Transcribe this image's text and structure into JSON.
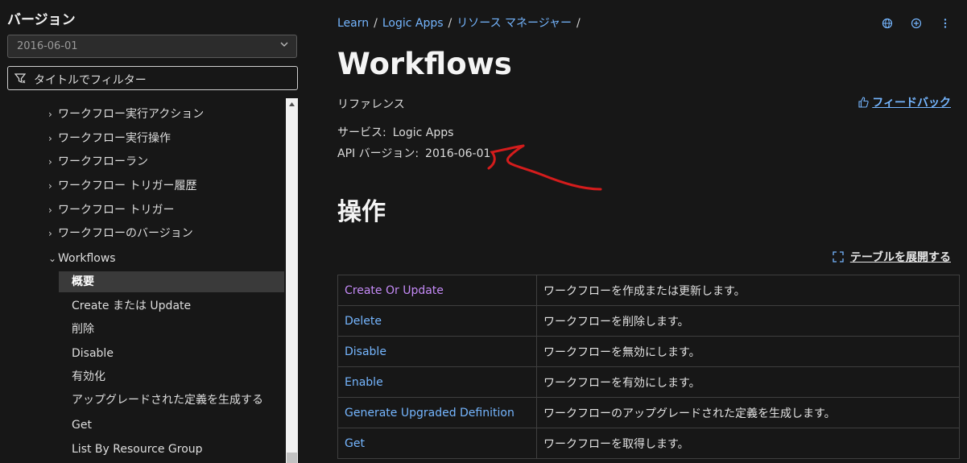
{
  "sidebar": {
    "title": "バージョン",
    "version": "2016-06-01",
    "filter_placeholder": "タイトルでフィルター",
    "items": [
      {
        "label": "ワークフロー実行アクション",
        "arrow": "›"
      },
      {
        "label": "ワークフロー実行操作",
        "arrow": "›"
      },
      {
        "label": "ワークフローラン",
        "arrow": "›"
      },
      {
        "label": "ワークフロー トリガー履歴",
        "arrow": "›"
      },
      {
        "label": "ワークフロー トリガー",
        "arrow": "›"
      },
      {
        "label": "ワークフローのバージョン",
        "arrow": "›"
      },
      {
        "label": "Workflows",
        "arrow": "⌄"
      },
      {
        "label": "概要"
      },
      {
        "label": "Create または Update"
      },
      {
        "label": "削除"
      },
      {
        "label": "Disable"
      },
      {
        "label": "有効化"
      },
      {
        "label": "アップグレードされた定義を生成する"
      },
      {
        "label": "Get"
      },
      {
        "label": "List By Resource Group"
      }
    ]
  },
  "breadcrumb": {
    "items": [
      "Learn",
      "Logic Apps",
      "リソース マネージャー"
    ],
    "separator": "/"
  },
  "page": {
    "title": "Workflows",
    "reference_label": "リファレンス",
    "feedback_label": "フィードバック",
    "service_label": "サービス:",
    "service_value": "Logic Apps",
    "api_label": "API バージョン:",
    "api_value": "2016-06-01",
    "section_title": "操作",
    "expand_table_label": "テーブルを展開する"
  },
  "operations": [
    {
      "name": "Create Or Update",
      "description": "ワークフローを作成または更新します。"
    },
    {
      "name": "Delete",
      "description": "ワークフローを削除します。"
    },
    {
      "name": "Disable",
      "description": "ワークフローを無効にします。"
    },
    {
      "name": "Enable",
      "description": "ワークフローを有効にします。"
    },
    {
      "name": "Generate Upgraded Definition",
      "description": "ワークフローのアップグレードされた定義を生成します。"
    },
    {
      "name": "Get",
      "description": "ワークフローを取得します。"
    }
  ],
  "colors": {
    "background": "#171717",
    "link": "#75b6ff",
    "visited_link": "#c48af6",
    "annotation": "#d41c1c"
  }
}
